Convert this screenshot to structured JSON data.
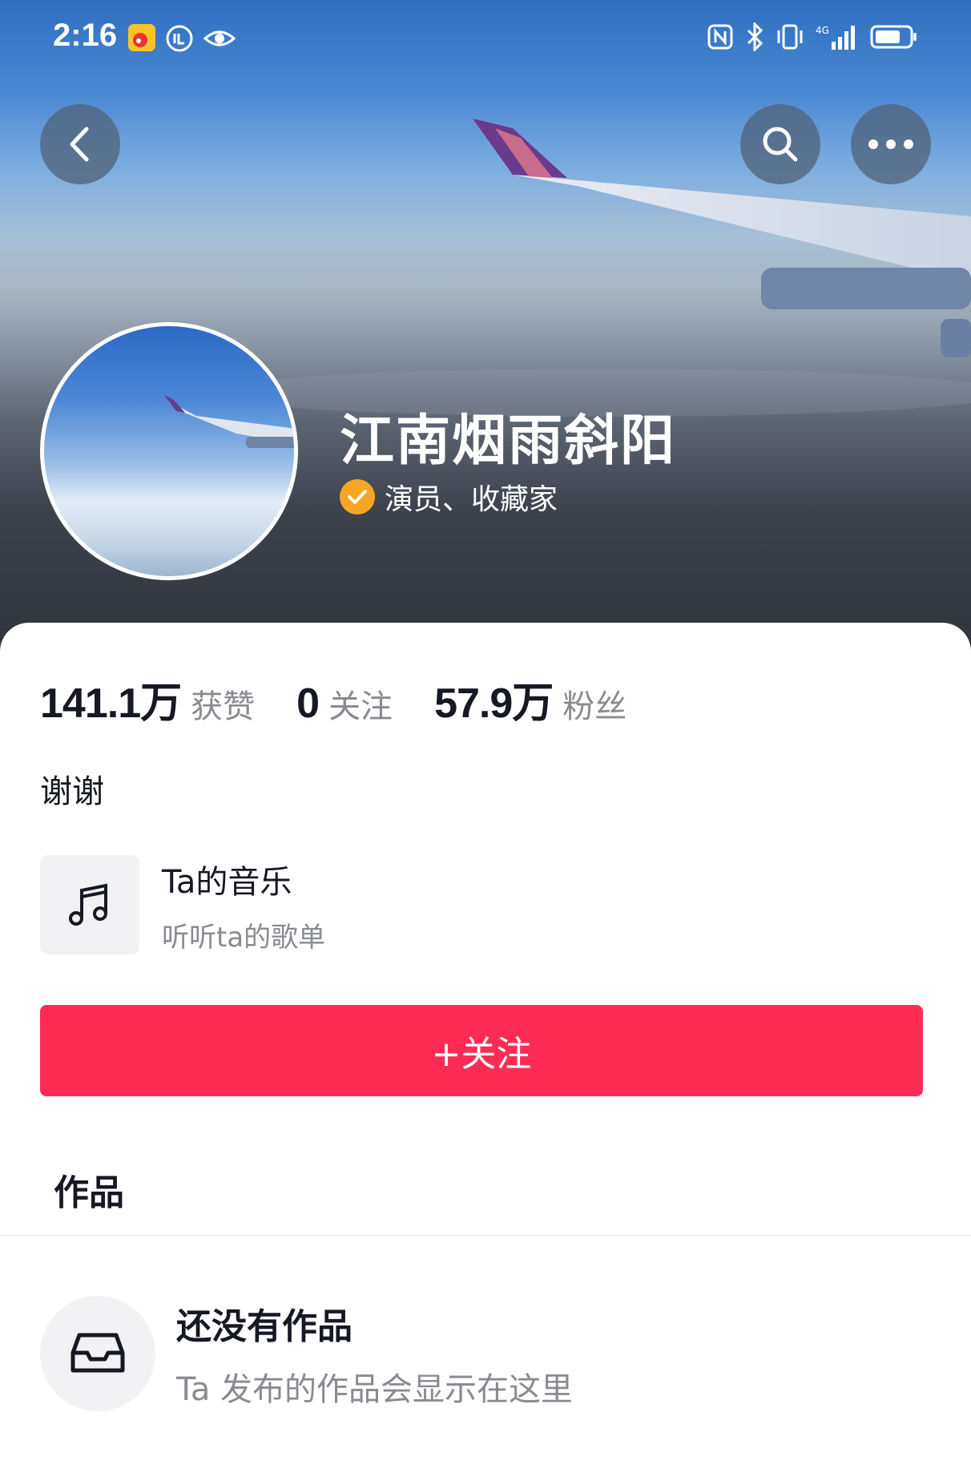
{
  "status_bar": {
    "time": "2:16",
    "left_icons": [
      "weibo-icon",
      "app-badge-icon",
      "eye-icon"
    ],
    "right_icons": [
      "nfc-icon",
      "bluetooth-icon",
      "vibrate-icon",
      "signal-4g-icon",
      "battery-icon"
    ]
  },
  "header": {
    "back_icon": "chevron-left-icon",
    "search_icon": "search-icon",
    "more_icon": "more-dots-icon"
  },
  "profile": {
    "name": "江南烟雨斜阳",
    "verified_label": "演员、收藏家",
    "verified_color": "#f5a623"
  },
  "stats": [
    {
      "value": "141.1万",
      "label": "获赞"
    },
    {
      "value": "0",
      "label": "关注"
    },
    {
      "value": "57.9万",
      "label": "粉丝"
    }
  ],
  "bio": "谢谢",
  "music": {
    "title": "Ta的音乐",
    "subtitle": "听听ta的歌单",
    "icon": "music-note-icon"
  },
  "follow_button": {
    "label": "+关注",
    "color": "#fe2c55"
  },
  "tabs": {
    "works_label": "作品"
  },
  "empty_state": {
    "title": "还没有作品",
    "subtitle": "Ta 发布的作品会显示在这里",
    "icon": "inbox-tray-icon"
  }
}
